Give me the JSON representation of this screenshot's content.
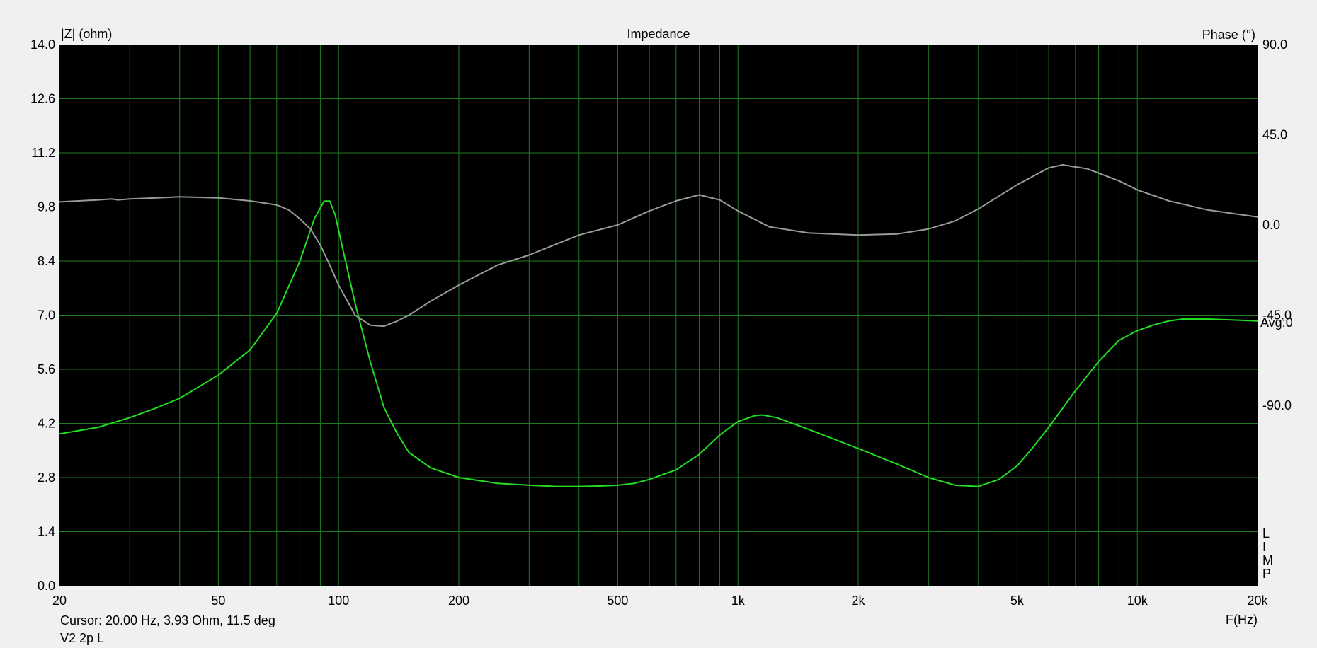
{
  "chart_data": {
    "type": "line",
    "title": "Impedance",
    "ylabel": "|Z| (ohm)",
    "y2label": "Phase (°)",
    "xlabel": "F(Hz)",
    "xscale": "log",
    "xlim": [
      20,
      20000
    ],
    "ylim": [
      0,
      14
    ],
    "y2lim": [
      -180,
      90
    ],
    "x_ticks": [
      20,
      50,
      100,
      200,
      500,
      1000,
      2000,
      5000,
      10000,
      20000
    ],
    "x_tick_labels": [
      "20",
      "50",
      "100",
      "200",
      "500",
      "1k",
      "2k",
      "5k",
      "10k",
      "20k"
    ],
    "y_ticks": [
      0.0,
      1.4,
      2.8,
      4.2,
      5.6,
      7.0,
      8.4,
      9.8,
      11.2,
      12.6,
      14.0
    ],
    "y_tick_labels": [
      "0.0",
      "1.4",
      "2.8",
      "4.2",
      "5.6",
      "7.0",
      "8.4",
      "9.8",
      "11.2",
      "12.6",
      "14.0"
    ],
    "y2_ticks": [
      90,
      45,
      0,
      -45,
      -90
    ],
    "y2_tick_labels": [
      "90.0",
      "45.0",
      "0.0",
      "-45.0",
      "-90.0"
    ],
    "avg_label": "Avg:0",
    "lim_marker": [
      "L",
      "I",
      "M",
      "P"
    ],
    "grid": true,
    "colors": {
      "background": "#000000",
      "grid": "#1f7a1f",
      "impedance": "#22dd22",
      "phase": "#9a9a9a"
    },
    "series": [
      {
        "axis": "left",
        "color": "#22dd22",
        "points": [
          [
            20,
            3.93
          ],
          [
            25,
            4.1
          ],
          [
            30,
            4.35
          ],
          [
            35,
            4.6
          ],
          [
            40,
            4.85
          ],
          [
            50,
            5.45
          ],
          [
            60,
            6.1
          ],
          [
            70,
            7.05
          ],
          [
            80,
            8.4
          ],
          [
            87,
            9.5
          ],
          [
            92,
            9.95
          ],
          [
            95,
            9.95
          ],
          [
            98,
            9.6
          ],
          [
            103,
            8.6
          ],
          [
            110,
            7.3
          ],
          [
            120,
            5.8
          ],
          [
            130,
            4.6
          ],
          [
            140,
            3.95
          ],
          [
            150,
            3.45
          ],
          [
            170,
            3.05
          ],
          [
            200,
            2.8
          ],
          [
            250,
            2.65
          ],
          [
            300,
            2.6
          ],
          [
            350,
            2.57
          ],
          [
            400,
            2.57
          ],
          [
            450,
            2.58
          ],
          [
            500,
            2.6
          ],
          [
            550,
            2.65
          ],
          [
            600,
            2.75
          ],
          [
            700,
            3.0
          ],
          [
            800,
            3.4
          ],
          [
            900,
            3.9
          ],
          [
            1000,
            4.25
          ],
          [
            1100,
            4.4
          ],
          [
            1150,
            4.42
          ],
          [
            1250,
            4.35
          ],
          [
            1500,
            4.05
          ],
          [
            2000,
            3.55
          ],
          [
            2500,
            3.15
          ],
          [
            3000,
            2.8
          ],
          [
            3500,
            2.6
          ],
          [
            4000,
            2.57
          ],
          [
            4500,
            2.75
          ],
          [
            5000,
            3.1
          ],
          [
            5500,
            3.6
          ],
          [
            6000,
            4.1
          ],
          [
            7000,
            5.05
          ],
          [
            8000,
            5.8
          ],
          [
            9000,
            6.35
          ],
          [
            10000,
            6.6
          ],
          [
            11000,
            6.75
          ],
          [
            12000,
            6.85
          ],
          [
            13000,
            6.9
          ],
          [
            15000,
            6.9
          ],
          [
            17000,
            6.88
          ],
          [
            20000,
            6.85
          ]
        ]
      },
      {
        "axis": "right",
        "color": "#9a9a9a",
        "points": [
          [
            20,
            11.5
          ],
          [
            25,
            12.5
          ],
          [
            27,
            13.0
          ],
          [
            28,
            12.5
          ],
          [
            30,
            13.0
          ],
          [
            35,
            13.5
          ],
          [
            40,
            14.0
          ],
          [
            50,
            13.5
          ],
          [
            60,
            12.0
          ],
          [
            70,
            10.0
          ],
          [
            75,
            7.5
          ],
          [
            80,
            3.0
          ],
          [
            85,
            -2.0
          ],
          [
            90,
            -10.0
          ],
          [
            95,
            -20.0
          ],
          [
            100,
            -30.0
          ],
          [
            110,
            -45.0
          ],
          [
            120,
            -50.0
          ],
          [
            130,
            -50.5
          ],
          [
            140,
            -48.0
          ],
          [
            150,
            -45.0
          ],
          [
            170,
            -38.0
          ],
          [
            200,
            -30.0
          ],
          [
            250,
            -20.0
          ],
          [
            300,
            -15.0
          ],
          [
            400,
            -5.0
          ],
          [
            500,
            0.0
          ],
          [
            600,
            7.0
          ],
          [
            700,
            12.0
          ],
          [
            800,
            15.0
          ],
          [
            900,
            12.5
          ],
          [
            1000,
            7.0
          ],
          [
            1200,
            -1.0
          ],
          [
            1500,
            -4.0
          ],
          [
            2000,
            -5.0
          ],
          [
            2500,
            -4.5
          ],
          [
            3000,
            -2.0
          ],
          [
            3500,
            2.0
          ],
          [
            4000,
            8.0
          ],
          [
            5000,
            20.0
          ],
          [
            6000,
            28.5
          ],
          [
            6500,
            30.0
          ],
          [
            7500,
            28.0
          ],
          [
            9000,
            22.0
          ],
          [
            10000,
            17.5
          ],
          [
            12000,
            12.0
          ],
          [
            15000,
            7.5
          ],
          [
            20000,
            4.0
          ]
        ]
      }
    ]
  },
  "footer": {
    "cursor_text": "Cursor: 20.00 Hz, 3.93 Ohm, 11.5 deg",
    "trace_name": "V2 2p L"
  }
}
